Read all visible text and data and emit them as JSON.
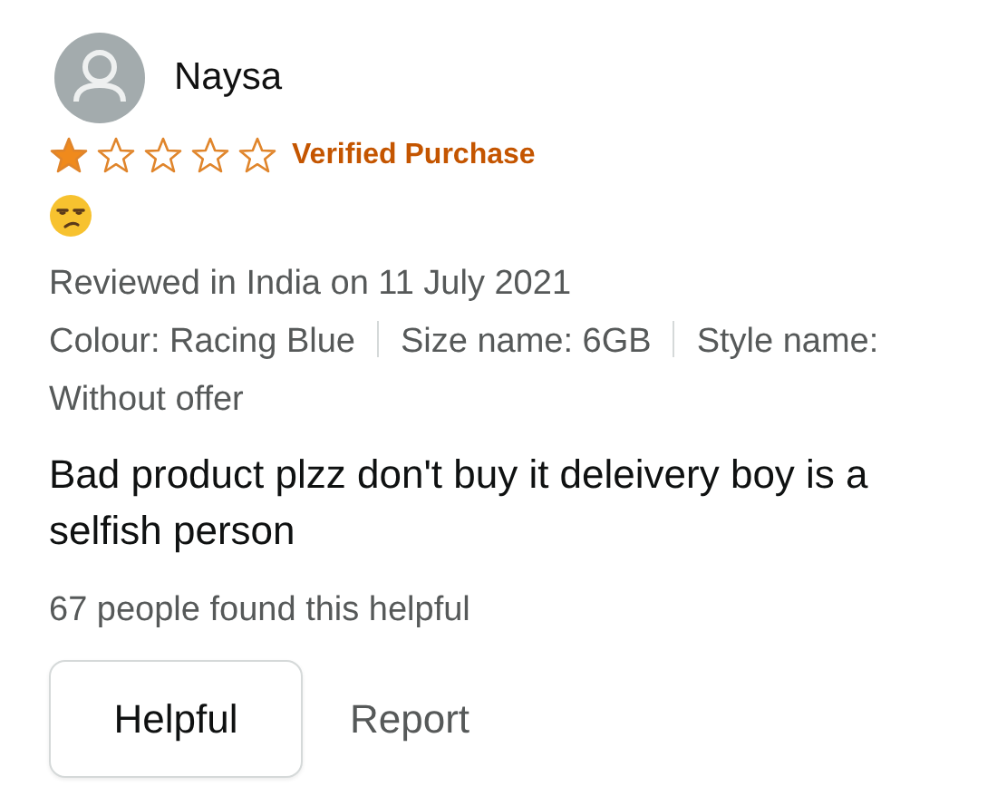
{
  "review": {
    "author": "Naysa",
    "stars": 1,
    "badge": "Verified Purchase",
    "date_line": "Reviewed in India on 11 July 2021",
    "attributes": [
      "Colour: Racing Blue",
      "Size name: 6GB",
      "Style name: Without offer"
    ],
    "body": "Bad product plzz don't buy it deleivery boy is a selfish person",
    "helpful_count": "67 people found this helpful",
    "buttons": [
      {
        "label": "Helpful",
        "kind": "outlined"
      },
      {
        "label": "Report",
        "kind": "plain"
      }
    ]
  }
}
